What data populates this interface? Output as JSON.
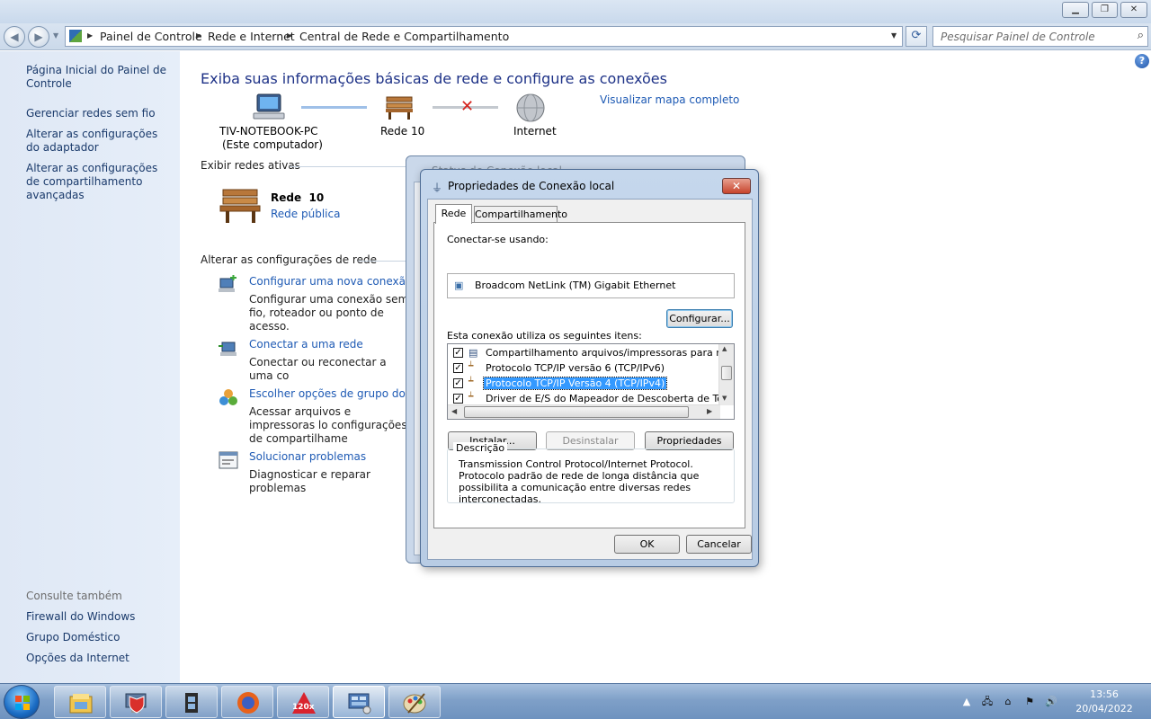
{
  "breadcrumb": {
    "items": [
      "Painel de Controle",
      "Rede e Internet",
      "Central de Rede e Compartilhamento"
    ]
  },
  "search": {
    "placeholder": "Pesquisar Painel de Controle"
  },
  "sidebar": {
    "links": [
      "Página Inicial do Painel de Controle",
      "Gerenciar redes sem fio",
      "Alterar as configurações do adaptador",
      "Alterar as configurações de compartilhamento avançadas"
    ],
    "see_also_heading": "Consulte também",
    "see_also": [
      "Firewall do Windows",
      "Grupo Doméstico",
      "Opções da Internet"
    ]
  },
  "main": {
    "heading": "Exiba suas informações básicas de rede e configure as conexões",
    "map_link": "Visualizar mapa completo",
    "nodes": {
      "computer": "TIV-NOTEBOOK-PC",
      "computer_sub": "(Este computador)",
      "network": "Rede 10",
      "internet": "Internet"
    },
    "active_networks_heading": "Exibir redes ativas",
    "active_network": {
      "name": "Rede  10",
      "type": "Rede pública"
    },
    "change_settings_heading": "Alterar as configurações de rede",
    "tasks": [
      {
        "title": "Configurar uma nova conexão ou",
        "desc": "Configurar uma conexão sem fio, roteador ou ponto de acesso."
      },
      {
        "title": "Conectar a uma rede",
        "desc": "Conectar ou reconectar a uma co"
      },
      {
        "title": "Escolher opções de grupo domés",
        "desc": "Acessar arquivos e impressoras lo configurações de compartilhame"
      },
      {
        "title": "Solucionar problemas",
        "desc": "Diagnosticar e reparar problemas"
      }
    ]
  },
  "back_dialog": {
    "title": "Status de Conexão local"
  },
  "dialog": {
    "title": "Propriedades de Conexão local",
    "tabs": [
      "Rede",
      "Compartilhamento"
    ],
    "connect_using_label": "Conectar-se usando:",
    "adapter": "Broadcom NetLink (TM) Gigabit Ethernet",
    "configure_button": "Configurar...",
    "items_label": "Esta conexão utiliza os seguintes itens:",
    "items": [
      {
        "label": "Compartilhamento arquivos/impressoras para redes Mic",
        "checked": true,
        "selected": false
      },
      {
        "label": "Protocolo TCP/IP versão 6 (TCP/IPv6)",
        "checked": true,
        "selected": false
      },
      {
        "label": "Protocolo TCP/IP Versão 4 (TCP/IPv4)",
        "checked": true,
        "selected": true
      },
      {
        "label": "Driver de E/S do Mapeador de Descoberta de Topoloc",
        "checked": true,
        "selected": false
      }
    ],
    "install_button": "Instalar...",
    "uninstall_button": "Desinstalar",
    "properties_button": "Propriedades",
    "description_heading": "Descrição",
    "description_text": "Transmission Control Protocol/Internet Protocol. Protocolo padrão de rede de longa distância que possibilita a comunicação entre diversas redes interconectadas.",
    "ok_button": "OK",
    "cancel_button": "Cancelar"
  },
  "taskbar": {
    "time": "13:56",
    "date": "20/04/2022",
    "apps": [
      "explorer-icon",
      "monitor-shield-icon",
      "film-icon",
      "firefox-icon",
      "autocad-icon",
      "control-panel-icon",
      "paint-icon"
    ],
    "app_badge": "120x"
  },
  "colors": {
    "link": "#1e5ab4",
    "heading": "#1e3287",
    "selection": "#3399ff"
  }
}
